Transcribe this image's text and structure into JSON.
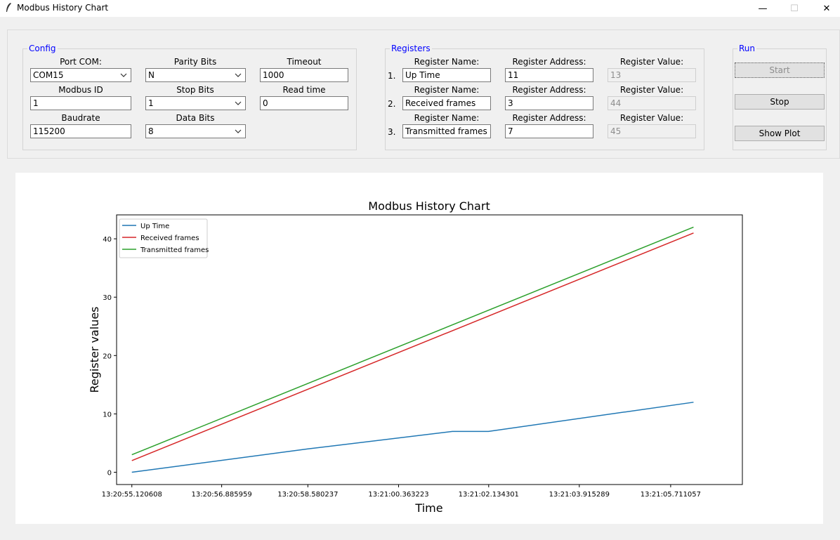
{
  "window": {
    "title": "Modbus History Chart",
    "minimize_glyph": "—",
    "maximize_glyph": "☐",
    "close_glyph": "✕"
  },
  "config": {
    "legend": "Config",
    "port_com": {
      "label": "Port COM:",
      "value": "COM15"
    },
    "parity_bits": {
      "label": "Parity Bits",
      "value": "N"
    },
    "timeout": {
      "label": "Timeout",
      "value": "1000"
    },
    "modbus_id": {
      "label": "Modbus ID",
      "value": "1"
    },
    "stop_bits": {
      "label": "Stop Bits",
      "value": "1"
    },
    "read_time": {
      "label": "Read time",
      "value": "0"
    },
    "baudrate": {
      "label": "Baudrate",
      "value": "115200"
    },
    "data_bits": {
      "label": "Data Bits",
      "value": "8"
    }
  },
  "registers": {
    "legend": "Registers",
    "rows": [
      {
        "num": "1.",
        "name_label": "Register Name:",
        "name": "Up Time",
        "address_label": "Register Address:",
        "address": "11",
        "value_label": "Register Value:",
        "value": "13"
      },
      {
        "num": "2.",
        "name_label": "Register Name:",
        "name": "Received frames",
        "address_label": "Register Address:",
        "address": "3",
        "value_label": "Register Value:",
        "value": "44"
      },
      {
        "num": "3.",
        "name_label": "Register Name:",
        "name": "Transmitted frames",
        "address_label": "Register Address:",
        "address": "7",
        "value_label": "Register Value:",
        "value": "45"
      }
    ]
  },
  "run": {
    "legend": "Run",
    "start": "Start",
    "stop": "Stop",
    "show_plot": "Show Plot"
  },
  "colors": {
    "up_time": "#1f77b4",
    "received": "#d62728",
    "transmitted": "#2ca02c",
    "legend_blue": "#0000ff"
  },
  "chart_data": {
    "type": "line",
    "title": "Modbus History Chart",
    "xlabel": "Time",
    "ylabel": "Register values",
    "x_ticks": [
      "13:20:55.120608",
      "13:20:56.885959",
      "13:20:58.580237",
      "13:21:00.363223",
      "13:21:02.134301",
      "13:21:03.915289",
      "13:21:05.711057"
    ],
    "x_seconds_range": [
      -0.3,
      12.0
    ],
    "x_tick_seconds": [
      0,
      1.7654,
      3.4596,
      5.2426,
      7.0137,
      8.7947,
      10.5905
    ],
    "y_ticks": [
      0,
      10,
      20,
      30,
      40
    ],
    "ylim": [
      -2.1,
      44.1
    ],
    "grid": false,
    "legend_position": "upper left",
    "series": [
      {
        "name": "Up Time",
        "color": "#1f77b4",
        "x": [
          0,
          3.46,
          6.3,
          7.01,
          11.04
        ],
        "y": [
          0,
          4,
          7,
          7,
          12
        ]
      },
      {
        "name": "Received frames",
        "color": "#d62728",
        "x": [
          0,
          11.04
        ],
        "y": [
          2,
          41
        ]
      },
      {
        "name": "Transmitted frames",
        "color": "#2ca02c",
        "x": [
          0,
          11.04
        ],
        "y": [
          3,
          42
        ]
      }
    ]
  }
}
